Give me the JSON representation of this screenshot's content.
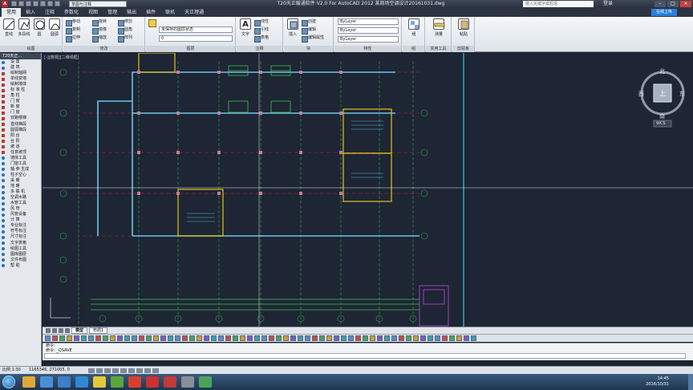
{
  "window": {
    "title": "T20天正暖通软件 V2.0 For AutoCAD 2012    某商场空调设计20161031.dwg",
    "workspace": "草图与注释",
    "search_placeholder": "键入关键字或短语",
    "login": "登录",
    "app_logo": "A"
  },
  "ribbon_tabs": [
    "常用",
    "插入",
    "注释",
    "参数化",
    "视图",
    "管理",
    "输出",
    "插件",
    "联机",
    "天正理通"
  ],
  "online_button": "在线上传",
  "ribbon": {
    "draw": {
      "title": "绘图",
      "tools": [
        "直线",
        "多段线",
        "圆",
        "圆弧"
      ]
    },
    "modify": {
      "title": "修改",
      "tools": [
        "移动",
        "旋转",
        "修剪",
        "复制",
        "镜像",
        "圆角",
        "拉伸",
        "缩放",
        "阵列"
      ]
    },
    "layers": {
      "title": "图层",
      "combo": "未保存的图层状态",
      "current": "0"
    },
    "annotation": {
      "title": "注释",
      "tools": [
        "文字",
        "线性",
        "引线",
        "表格"
      ]
    },
    "block": {
      "title": "块",
      "tools": [
        "插入",
        "创建",
        "编辑",
        "编辑属性"
      ]
    },
    "properties": {
      "title": "特性",
      "color": "ByLayer",
      "linetype": "ByLayer",
      "lineweight": "ByLayer",
      "match": "特性匹配"
    },
    "groups": {
      "title": "组",
      "tool": "组"
    },
    "utilities": {
      "title": "实用工具",
      "tool": "测量"
    },
    "clipboard": {
      "title": "剪贴板",
      "tool": "粘贴"
    }
  },
  "palette": {
    "title": "T20天正...",
    "items": [
      {
        "label": "设    置",
        "kind": "sec"
      },
      {
        "label": "建    筑",
        "kind": "sec"
      },
      {
        "label": "绘制轴网",
        "kind": "sub"
      },
      {
        "label": "单线变墙",
        "kind": "sub"
      },
      {
        "label": "绘制墙体",
        "kind": "sub"
      },
      {
        "label": "标 准 柱",
        "kind": "sub"
      },
      {
        "label": "角    柱",
        "kind": "sub"
      },
      {
        "label": "门    窗",
        "kind": "sub"
      },
      {
        "label": "新    窗",
        "kind": "sub"
      },
      {
        "label": "门    窗",
        "kind": "sub"
      },
      {
        "label": "双跑楼梯",
        "kind": "sub"
      },
      {
        "label": "直线梯段",
        "kind": "sub"
      },
      {
        "label": "圆弧梯段",
        "kind": "sub"
      },
      {
        "label": "阳    台",
        "kind": "sub"
      },
      {
        "label": "台    阶",
        "kind": "sub"
      },
      {
        "label": "坡    道",
        "kind": "sub"
      },
      {
        "label": "任意坡顶",
        "kind": "sub"
      },
      {
        "label": "墙体工具",
        "kind": "sec"
      },
      {
        "label": "门窗工具",
        "kind": "sec"
      },
      {
        "label": "轴 参 生成",
        "kind": "sec"
      },
      {
        "label": "柱子空心",
        "kind": "sec"
      },
      {
        "label": "采    暖",
        "kind": "sec"
      },
      {
        "label": "地    暖",
        "kind": "sec"
      },
      {
        "label": "多 联 机",
        "kind": "sec"
      },
      {
        "label": "空调水路",
        "kind": "sec"
      },
      {
        "label": "水管工具",
        "kind": "sec"
      },
      {
        "label": "风    管",
        "kind": "sec"
      },
      {
        "label": "风管设备",
        "kind": "sec"
      },
      {
        "label": "计    算",
        "kind": "sec"
      },
      {
        "label": "专业标注",
        "kind": "sec"
      },
      {
        "label": "符号标注",
        "kind": "sec"
      },
      {
        "label": "尺寸标注",
        "kind": "sec"
      },
      {
        "label": "文字表格",
        "kind": "sec"
      },
      {
        "label": "绘图工具",
        "kind": "sec"
      },
      {
        "label": "图库图层",
        "kind": "sec"
      },
      {
        "label": "文件布图",
        "kind": "sec"
      },
      {
        "label": "帮    助",
        "kind": "sec"
      }
    ]
  },
  "viewport_label": "[-][俯视][二维线框]",
  "viewcube": {
    "north": "北",
    "south": "南",
    "east": "东",
    "west": "西",
    "top": "上",
    "wcs": "WCS"
  },
  "layout_tabs": [
    "模型",
    "布局1"
  ],
  "command": {
    "line1": "命令:",
    "line2": "命令:  _QSAVE",
    "input_placeholder": ""
  },
  "status": {
    "scale": "比例 1:30",
    "coords": "1165346, 271005, 0"
  },
  "taskbar": {
    "time": "14:45",
    "date": "2016/10/31"
  }
}
